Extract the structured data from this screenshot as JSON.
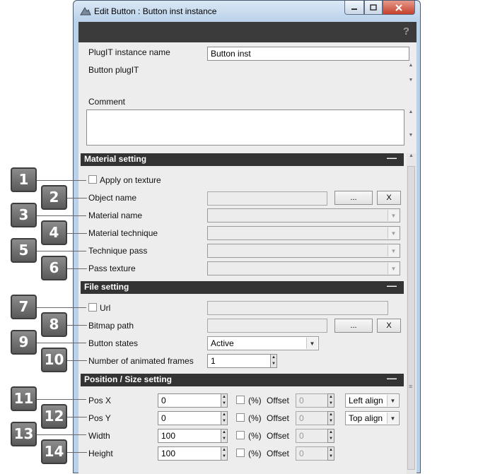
{
  "window": {
    "title": "Edit Button : Button inst instance",
    "help_glyph": "?"
  },
  "header": {
    "instance_name_label": "PlugIT instance name",
    "instance_name_value": "Button inst",
    "plugit_label": "Button plugIT",
    "comment_label": "Comment",
    "comment_value": ""
  },
  "material_section": {
    "title": "Material setting",
    "collapse": "—",
    "apply_on_texture": "Apply on texture",
    "object_name": "Object name",
    "browse": "...",
    "clear": "X",
    "material_name": "Material name",
    "material_technique": "Material technique",
    "technique_pass": "Technique pass",
    "pass_texture": "Pass texture"
  },
  "file_section": {
    "title": "File setting",
    "collapse": "—",
    "url": "Url",
    "bitmap_path": "Bitmap path",
    "browse": "...",
    "clear": "X",
    "button_states": "Button states",
    "button_states_value": "Active",
    "animated_frames": "Number of animated frames",
    "animated_frames_value": "1"
  },
  "position_section": {
    "title": "Position / Size setting",
    "collapse": "—",
    "percent": "(%)",
    "offset": "Offset",
    "rows": [
      {
        "label": "Pos X",
        "value": "0",
        "offset": "0",
        "align": "Left align"
      },
      {
        "label": "Pos Y",
        "value": "0",
        "offset": "0",
        "align": "Top align"
      },
      {
        "label": "Width",
        "value": "100",
        "offset": "0"
      },
      {
        "label": "Height",
        "value": "100",
        "offset": "0"
      }
    ]
  },
  "badges": [
    "1",
    "2",
    "3",
    "4",
    "5",
    "6",
    "7",
    "8",
    "9",
    "10",
    "11",
    "12",
    "13",
    "14"
  ],
  "colors": {
    "section_header": "#333333",
    "topbar": "#3b3b3b",
    "badge": "#6e6e6e",
    "window_frame": "#b9d1ea"
  }
}
